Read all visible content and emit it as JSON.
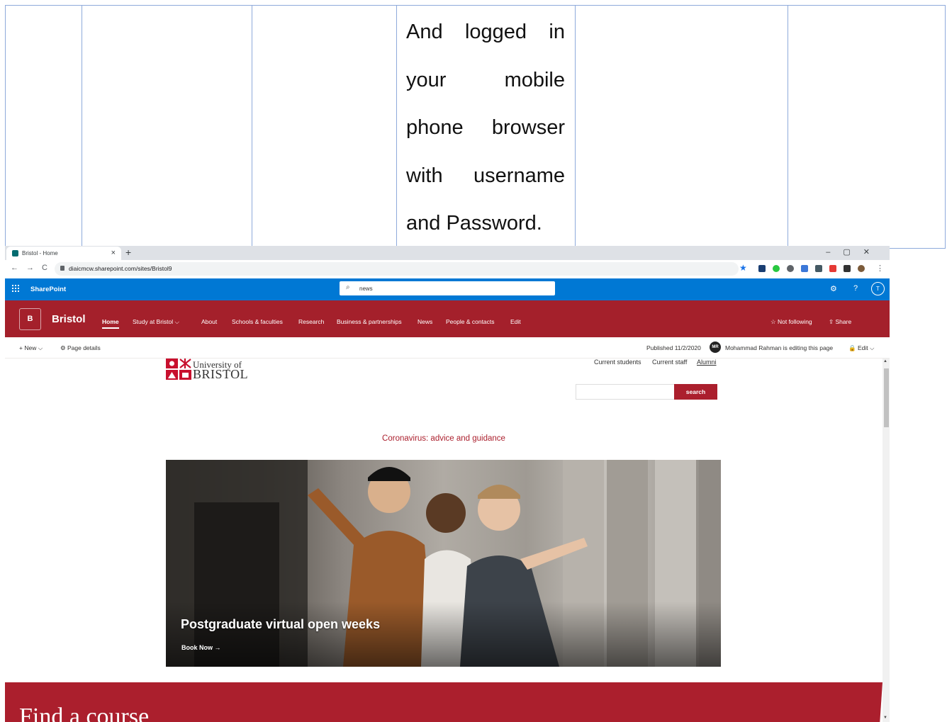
{
  "document": {
    "cell_lines": [
      "And logged in",
      "your mobile",
      "phone browser",
      "with username",
      "and Password."
    ]
  },
  "browser": {
    "tab_title": "Bristol - Home",
    "tab_close": "×",
    "new_tab": "+",
    "window_controls": "–▢✕",
    "url": "diaicmcw.sharepoint.com/sites/Bristol9",
    "back": "←",
    "forward": "→",
    "reload": "C",
    "bookmark_star": "★",
    "menu": "⋮"
  },
  "suitebar": {
    "app_name": "SharePoint",
    "search_value": "news",
    "search_icon": "⌕",
    "settings_icon": "⚙",
    "help_icon": "?",
    "user_initial": "T"
  },
  "site_header": {
    "logo_letter": "B",
    "site_title": "Bristol",
    "nav": [
      "Home",
      "Study at Bristol ⌵",
      "About",
      "Schools & faculties",
      "Research",
      "Business & partnerships",
      "News",
      "People & contacts",
      "Edit"
    ],
    "follow": "☆ Not following",
    "share": "⇪ Share"
  },
  "command_bar": {
    "new": "+ New ⌵",
    "page_details": "⚙ Page details",
    "published": "Published 11/2/2020",
    "editor_initials": "MR",
    "editing_status": "Mohammad Rahman is editing this page",
    "edit": "🔒 Edit ⌵"
  },
  "page": {
    "logo_line1": "University of",
    "logo_line2": "BRISTOL",
    "top_links": [
      "Current students",
      "Current staff",
      "Alumni"
    ],
    "search_button": "search",
    "covid_link": "Coronavirus: advice and guidance",
    "hero_title": "Postgraduate virtual open weeks",
    "hero_cta": "Book Now →",
    "find_course": "Find a course"
  },
  "colors": {
    "suitebar_blue": "#0078d4",
    "site_red": "#a4202b",
    "uob_red": "#ab1f2d"
  }
}
